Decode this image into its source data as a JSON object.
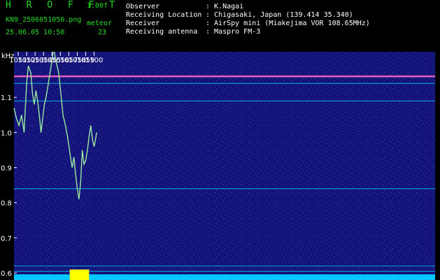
{
  "header": {
    "title": "H R O F F T",
    "version": "1.00f",
    "filename": "KN9_2506051050.png",
    "timestamp": "25.06.05 10:50",
    "meteor_label": "meteor",
    "meteor_count": "23",
    "info": [
      {
        "label": "Observer",
        "value": ": K.Nagai"
      },
      {
        "label": "Receiving Location",
        "value": ": Chigasaki, Japan (139.414 35.340)"
      },
      {
        "label": "Receiver",
        "value": ": AirSpy mini (Miakejima VOR 108.65MHz)"
      },
      {
        "label": "Receiving antenna",
        "value": ": Maspro FM-3"
      }
    ]
  },
  "colors": {
    "background": "#000000",
    "plot_background": "#141478",
    "header_green": "#22dd22",
    "trace": "#9be8a0",
    "carrier": "#ff60c0",
    "horizontal_line": "#00e0ff",
    "baseline_cyan": "#00c8ff",
    "baseline_yellow": "#ffff00"
  },
  "chart_data": {
    "type": "line",
    "ylabel": "kHz",
    "xlim": [
      1050.5,
      1100.4
    ],
    "ylim": [
      0.58,
      1.23
    ],
    "x_ticks": [
      "1051",
      "1052",
      "1053",
      "1054",
      "1055",
      "1056",
      "1057",
      "1058",
      "1059",
      "1100"
    ],
    "x_tick_values": [
      1051,
      1052,
      1053,
      1054,
      1055,
      1056,
      1057,
      1058,
      1059,
      1060
    ],
    "y_ticks": [
      "1.1",
      "1.0",
      "0.9",
      "0.8",
      "0.7",
      "0.6"
    ],
    "y_tick_values": [
      1.1,
      1.0,
      0.9,
      0.8,
      0.7,
      0.6
    ],
    "horizontal_lines": [
      1.16,
      1.14,
      1.09,
      0.84,
      0.62,
      0.605
    ],
    "series": [
      {
        "x": [
          1050.5,
          1050.8,
          1051.1,
          1051.4,
          1051.7,
          1051.8,
          1052.0,
          1052.2,
          1052.5,
          1052.7,
          1052.9,
          1053.1,
          1053.3,
          1053.5,
          1053.7,
          1053.9,
          1054.1,
          1054.3,
          1054.5,
          1054.7,
          1054.9,
          1055.2,
          1055.5,
          1055.8,
          1056.1,
          1056.3,
          1056.6,
          1056.9,
          1057.2,
          1057.4,
          1057.6,
          1057.8,
          1058.0,
          1058.2,
          1058.4,
          1058.6,
          1058.8,
          1059.0,
          1059.2,
          1059.4,
          1059.6,
          1059.8,
          1060.0,
          1060.3
        ],
        "y": [
          1.07,
          1.04,
          1.02,
          1.05,
          1.0,
          1.05,
          1.14,
          1.19,
          1.17,
          1.11,
          1.08,
          1.12,
          1.09,
          1.05,
          1.0,
          1.04,
          1.08,
          1.1,
          1.13,
          1.16,
          1.19,
          1.24,
          1.2,
          1.17,
          1.1,
          1.05,
          1.02,
          0.98,
          0.93,
          0.9,
          0.93,
          0.88,
          0.84,
          0.81,
          0.86,
          0.95,
          0.91,
          0.92,
          0.95,
          0.99,
          1.02,
          0.98,
          0.96,
          1.0
        ]
      }
    ]
  }
}
